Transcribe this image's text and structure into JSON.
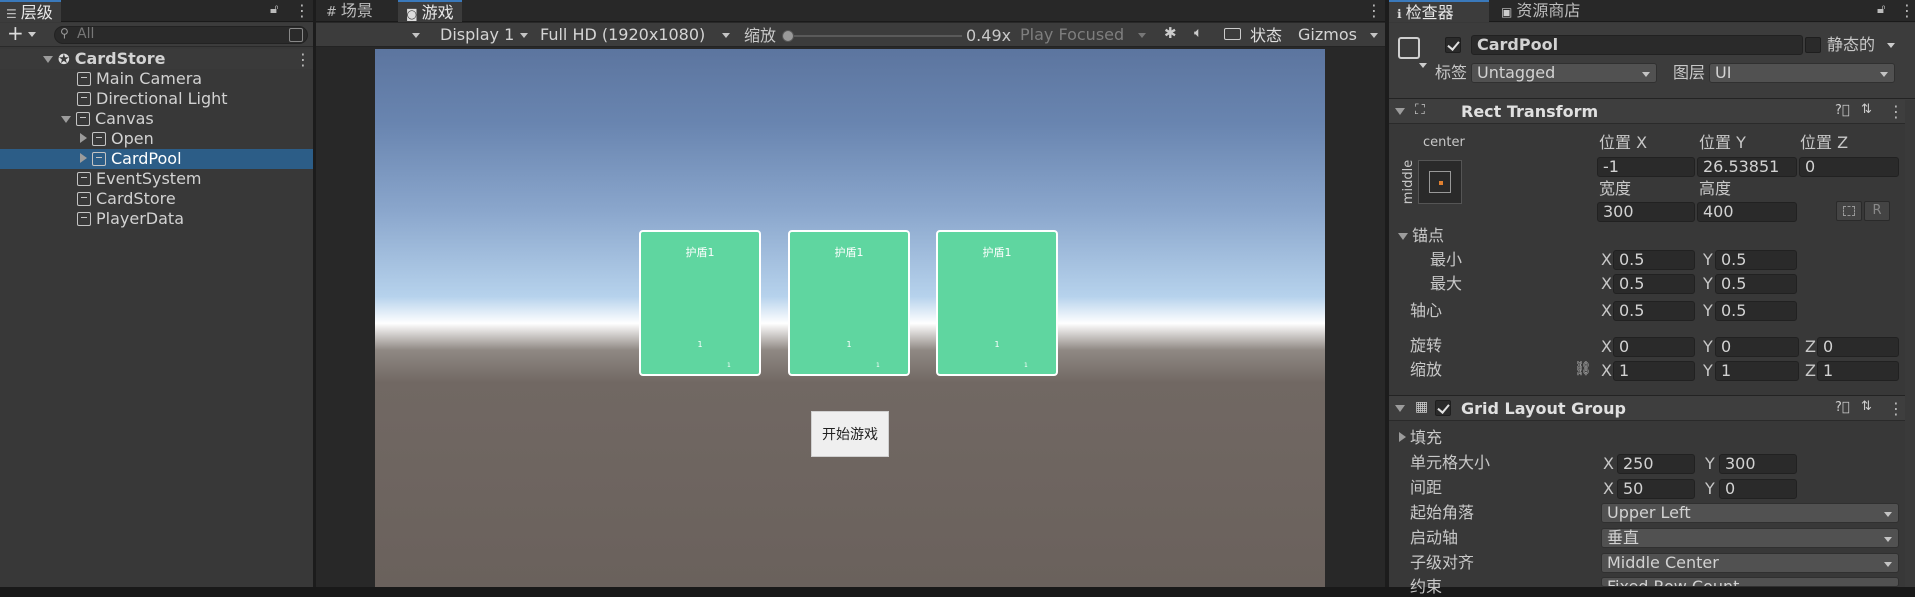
{
  "hierarchy": {
    "tab_label": "层级",
    "search_placeholder": "All",
    "scene_name": "CardStore",
    "items": [
      {
        "label": "Main Camera"
      },
      {
        "label": "Directional Light"
      },
      {
        "label": "Canvas"
      },
      {
        "label": "Open"
      },
      {
        "label": "CardPool"
      },
      {
        "label": "EventSystem"
      },
      {
        "label": "CardStore"
      },
      {
        "label": "PlayerData"
      }
    ]
  },
  "game_view": {
    "tabs": [
      {
        "label": "场景"
      },
      {
        "label": "游戏"
      }
    ],
    "display": "Display 1",
    "resolution": "Full HD (1920x1080)",
    "scale_label": "缩放",
    "scale_value": "0.49x",
    "scale_fraction": 0.0,
    "play_mode": "Play Focused",
    "stats_label": "状态",
    "gizmos_label": "Gizmos",
    "cards": [
      {
        "title": "护盾1",
        "number": "1",
        "small": "1"
      },
      {
        "title": "护盾1",
        "number": "1",
        "small": "1"
      },
      {
        "title": "护盾1",
        "number": "1",
        "small": "1"
      }
    ],
    "start_button": "开始游戏"
  },
  "inspector": {
    "tabs": [
      {
        "label": "检查器"
      },
      {
        "label": "资源商店"
      }
    ],
    "object_name": "CardPool",
    "static_label": "静态的",
    "tag_label": "标签",
    "tag_value": "Untagged",
    "layer_label": "图层",
    "layer_value": "UI",
    "rect_transform": {
      "title": "Rect Transform",
      "anchor_h": "center",
      "anchor_v": "middle",
      "pos_x_label": "位置 X",
      "pos_x": "-1",
      "pos_y_label": "位置 Y",
      "pos_y": "26.53851",
      "pos_z_label": "位置 Z",
      "pos_z": "0",
      "width_label": "宽度",
      "width": "300",
      "height_label": "高度",
      "height": "400",
      "r_button": "R",
      "anchors_label": "锚点",
      "min_label": "最小",
      "min_x": "0.5",
      "min_y": "0.5",
      "max_label": "最大",
      "max_x": "0.5",
      "max_y": "0.5",
      "pivot_label": "轴心",
      "pivot_x": "0.5",
      "pivot_y": "0.5",
      "rotation_label": "旋转",
      "rot_x": "0",
      "rot_y": "0",
      "rot_z": "0",
      "scale_label": "缩放",
      "scale_x": "1",
      "scale_y": "1",
      "scale_z": "1",
      "x": "X",
      "y": "Y",
      "z": "Z"
    },
    "grid_layout": {
      "title": "Grid Layout Group",
      "padding_label": "填充",
      "cell_size_label": "单元格大小",
      "cell_x": "250",
      "cell_y": "300",
      "spacing_label": "间距",
      "spacing_x": "50",
      "spacing_y": "0",
      "start_corner_label": "起始角落",
      "start_corner": "Upper Left",
      "start_axis_label": "启动轴",
      "start_axis": "垂直",
      "child_align_label": "子级对齐",
      "child_align": "Middle Center",
      "constraint_label": "约束",
      "constraint": "Fixed Row Count"
    }
  },
  "colors": {
    "card": "#5fd6a0",
    "selection": "#2c5d87",
    "accent": "#3a79bb"
  }
}
